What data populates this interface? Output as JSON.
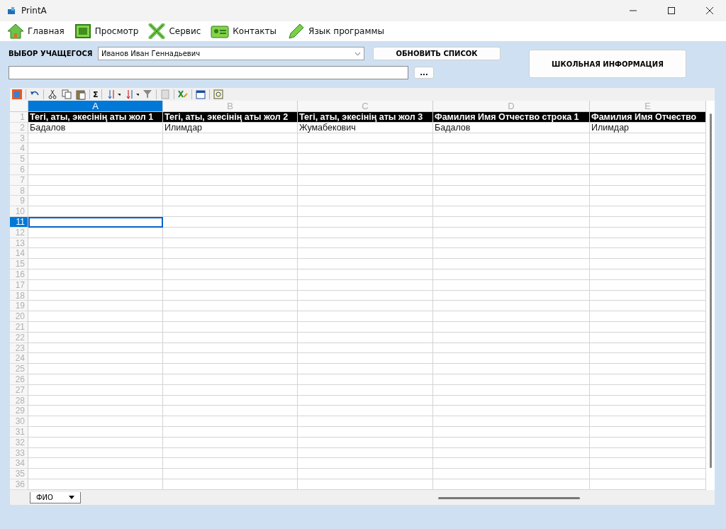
{
  "window": {
    "title": "PrintA"
  },
  "menu": [
    {
      "label": "Главная",
      "kind": "home"
    },
    {
      "label": "Просмотр",
      "kind": "view"
    },
    {
      "label": "Сервис",
      "kind": "tools"
    },
    {
      "label": "Контакты",
      "kind": "contacts"
    },
    {
      "label": "Язык программы",
      "kind": "language"
    }
  ],
  "student": {
    "label": "ВЫБОР УЧАЩЕГОСЯ",
    "value": "Иванов Иван Геннадьевич"
  },
  "refresh_button": "ОБНОВИТЬ СПИСОК",
  "school_button": "ШКОЛЬНАЯ ИНФОРМАЦИЯ",
  "browse_button": "...",
  "toolbar": {
    "sum": "Σ"
  },
  "columns": [
    {
      "label": "A",
      "selected": true
    },
    {
      "label": "B",
      "selected": false
    },
    {
      "label": "C",
      "selected": false
    },
    {
      "label": "D",
      "selected": false
    },
    {
      "label": "E",
      "selected": false
    }
  ],
  "rows": [
    {
      "number": "1",
      "kind": "header",
      "selected": false,
      "cells": [
        "Тегі, аты, экесінің аты жол 1",
        "Тегі, аты, экесінің аты жол 2",
        "Тегі, аты, экесінің аты жол 3",
        "Фамилия Имя Отчество строка 1",
        "Фамилия Имя Отчество"
      ]
    },
    {
      "number": "2",
      "kind": "data",
      "selected": false,
      "cells": [
        "Бадалов",
        "Илимдар",
        "Жумабекович",
        "Бадалов",
        "Илимдар"
      ]
    },
    {
      "number": "3",
      "kind": "data",
      "selected": false
    },
    {
      "number": "4",
      "kind": "data",
      "selected": false
    },
    {
      "number": "5",
      "kind": "data",
      "selected": false
    },
    {
      "number": "6",
      "kind": "data",
      "selected": false
    },
    {
      "number": "7",
      "kind": "data",
      "selected": false
    },
    {
      "number": "8",
      "kind": "data",
      "selected": false
    },
    {
      "number": "9",
      "kind": "data",
      "selected": false
    },
    {
      "number": "10",
      "kind": "data",
      "selected": false
    },
    {
      "number": "11",
      "kind": "data",
      "selected": true
    },
    {
      "number": "12",
      "kind": "data",
      "selected": false
    },
    {
      "number": "13",
      "kind": "data",
      "selected": false
    },
    {
      "number": "14",
      "kind": "data",
      "selected": false
    },
    {
      "number": "15",
      "kind": "data",
      "selected": false
    },
    {
      "number": "16",
      "kind": "data",
      "selected": false
    },
    {
      "number": "17",
      "kind": "data",
      "selected": false
    },
    {
      "number": "18",
      "kind": "data",
      "selected": false
    },
    {
      "number": "19",
      "kind": "data",
      "selected": false
    },
    {
      "number": "20",
      "kind": "data",
      "selected": false
    },
    {
      "number": "21",
      "kind": "data",
      "selected": false
    },
    {
      "number": "22",
      "kind": "data",
      "selected": false
    },
    {
      "number": "23",
      "kind": "data",
      "selected": false
    },
    {
      "number": "24",
      "kind": "data",
      "selected": false
    },
    {
      "number": "25",
      "kind": "data",
      "selected": false
    },
    {
      "number": "26",
      "kind": "data",
      "selected": false
    },
    {
      "number": "27",
      "kind": "data",
      "selected": false
    },
    {
      "number": "28",
      "kind": "data",
      "selected": false
    },
    {
      "number": "29",
      "kind": "data",
      "selected": false
    },
    {
      "number": "30",
      "kind": "data",
      "selected": false
    },
    {
      "number": "31",
      "kind": "data",
      "selected": false
    },
    {
      "number": "32",
      "kind": "data",
      "selected": false
    },
    {
      "number": "33",
      "kind": "data",
      "selected": false
    },
    {
      "number": "34",
      "kind": "data",
      "selected": false
    },
    {
      "number": "35",
      "kind": "data",
      "selected": false
    },
    {
      "number": "36",
      "kind": "data",
      "selected": false
    }
  ],
  "sheet_tabs": [
    {
      "label": "ФИО",
      "selected": true
    }
  ]
}
